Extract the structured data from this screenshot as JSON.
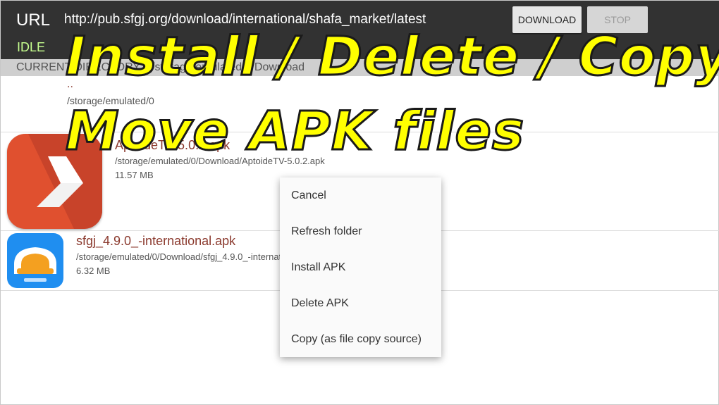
{
  "header": {
    "url_label": "URL",
    "url_value": "http://pub.sfgj.org/download/international/shafa_market/latest",
    "status": "IDLE",
    "download_label": "DOWNLOAD",
    "stop_label": "STOP"
  },
  "directory": {
    "label": "CURRENT DIRECTORY",
    "value": "/storage/emulated/0/Download"
  },
  "parent": {
    "name": "..",
    "path": "/storage/emulated/0"
  },
  "files": [
    {
      "name": "AptoideTV-5.0.2.apk",
      "path": "/storage/emulated/0/Download/AptoideTV-5.0.2.apk",
      "size": "11.57 MB"
    },
    {
      "name": "sfgj_4.9.0_-international.apk",
      "path": "/storage/emulated/0/Download/sfgj_4.9.0_-international.apk",
      "size": "6.32 MB"
    }
  ],
  "context_menu": {
    "items": [
      "Cancel",
      "Refresh folder",
      "Install APK",
      "Delete APK",
      "Copy (as file copy source)"
    ]
  },
  "overlay": {
    "line1": "Install / Delete / Copy",
    "line2": "Move APK files"
  },
  "colors": {
    "topbar": "#323232",
    "status_green": "#c6ff8f",
    "file_name": "#8b3a2e",
    "overlay_yellow": "#ffff00"
  }
}
